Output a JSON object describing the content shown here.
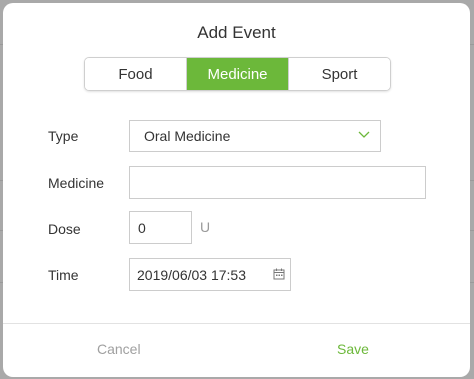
{
  "dialog": {
    "title": "Add Event",
    "tabs": [
      {
        "label": "Food"
      },
      {
        "label": "Medicine"
      },
      {
        "label": "Sport"
      }
    ],
    "active_tab": "Medicine",
    "form": {
      "type_label": "Type",
      "type_value": "Oral Medicine",
      "medicine_label": "Medicine",
      "medicine_value": "",
      "dose_label": "Dose",
      "dose_value": "0",
      "dose_unit": "U",
      "time_label": "Time",
      "time_value": "2019/06/03 17:53"
    },
    "buttons": {
      "cancel": "Cancel",
      "save": "Save"
    }
  },
  "colors": {
    "accent": "#6cb83a",
    "cancel_text": "#a0a0a0"
  },
  "icons": {
    "type_dropdown": "chevron-down-icon",
    "time_picker": "calendar-icon"
  }
}
